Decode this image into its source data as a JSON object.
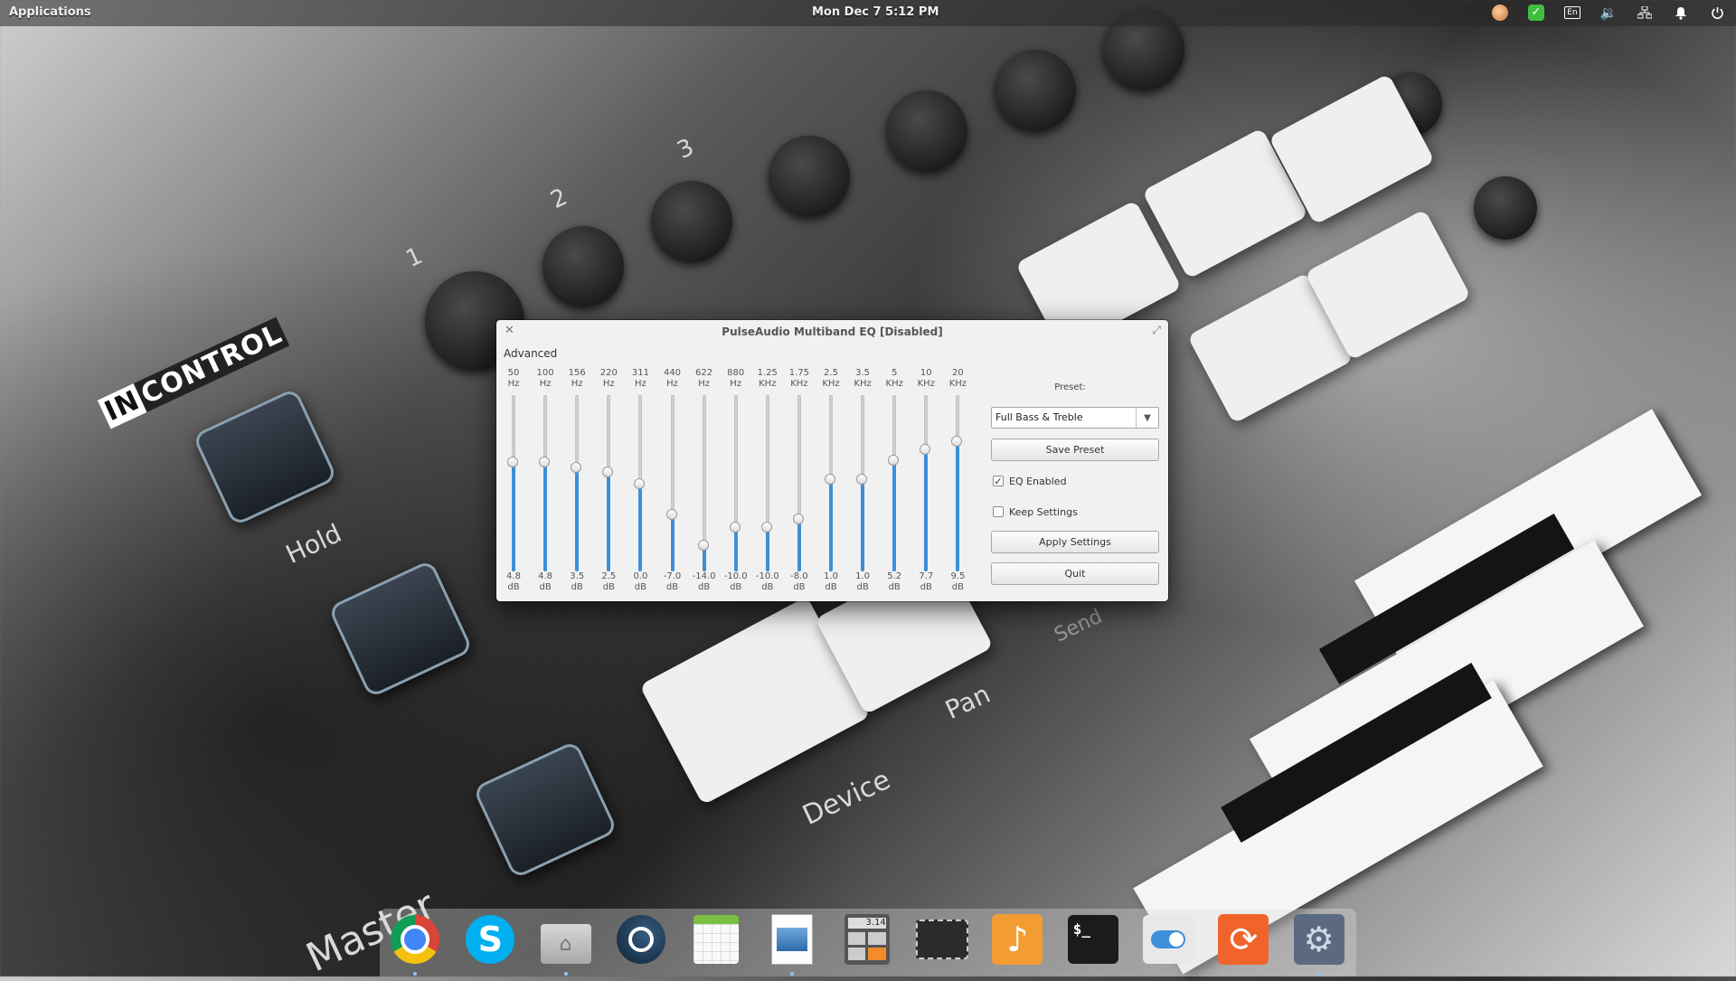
{
  "top_panel": {
    "applications": "Applications",
    "clock": "Mon Dec 7   5:12 PM",
    "keyboard_layout": "En"
  },
  "wallpaper": {
    "brand": "INCONTROL",
    "brand_in": "IN",
    "brand_control": "CONTROL",
    "hold": "Hold",
    "device": "Device",
    "pan": "Pan",
    "master": "Master",
    "send": "Send",
    "knob1": "1",
    "knob2": "2",
    "knob3": "3"
  },
  "eq_window": {
    "title": "PulseAudio Multiband EQ [Disabled]",
    "section": "Advanced",
    "bands": [
      {
        "freq": "50",
        "unit": "Hz",
        "value": "4.8",
        "db": "dB",
        "gain": 4.8
      },
      {
        "freq": "100",
        "unit": "Hz",
        "value": "4.8",
        "db": "dB",
        "gain": 4.8
      },
      {
        "freq": "156",
        "unit": "Hz",
        "value": "3.5",
        "db": "dB",
        "gain": 3.5
      },
      {
        "freq": "220",
        "unit": "Hz",
        "value": "2.5",
        "db": "dB",
        "gain": 2.5
      },
      {
        "freq": "311",
        "unit": "Hz",
        "value": "0.0",
        "db": "dB",
        "gain": 0.0
      },
      {
        "freq": "440",
        "unit": "Hz",
        "value": "-7.0",
        "db": "dB",
        "gain": -7.0
      },
      {
        "freq": "622",
        "unit": "Hz",
        "value": "-14.0",
        "db": "dB",
        "gain": -14.0
      },
      {
        "freq": "880",
        "unit": "Hz",
        "value": "-10.0",
        "db": "dB",
        "gain": -10.0
      },
      {
        "freq": "1.25",
        "unit": "KHz",
        "value": "-10.0",
        "db": "dB",
        "gain": -10.0
      },
      {
        "freq": "1.75",
        "unit": "KHz",
        "value": "-8.0",
        "db": "dB",
        "gain": -8.0
      },
      {
        "freq": "2.5",
        "unit": "KHz",
        "value": "1.0",
        "db": "dB",
        "gain": 1.0
      },
      {
        "freq": "3.5",
        "unit": "KHz",
        "value": "1.0",
        "db": "dB",
        "gain": 1.0
      },
      {
        "freq": "5",
        "unit": "KHz",
        "value": "5.2",
        "db": "dB",
        "gain": 5.2
      },
      {
        "freq": "10",
        "unit": "KHz",
        "value": "7.7",
        "db": "dB",
        "gain": 7.7
      },
      {
        "freq": "20",
        "unit": "KHz",
        "value": "9.5",
        "db": "dB",
        "gain": 9.5
      }
    ],
    "preset_label": "Preset:",
    "preset_value": "Full Bass & Treble",
    "save_preset": "Save Preset",
    "eq_enabled": "EQ Enabled",
    "eq_enabled_checked": true,
    "keep_settings": "Keep Settings",
    "keep_settings_checked": false,
    "apply_settings": "Apply Settings",
    "quit": "Quit"
  },
  "dock": {
    "items": [
      {
        "name": "chrome-icon"
      },
      {
        "name": "skype-icon"
      },
      {
        "name": "files-icon"
      },
      {
        "name": "steam-icon"
      },
      {
        "name": "calendar-icon"
      },
      {
        "name": "image-viewer-icon"
      },
      {
        "name": "calculator-icon",
        "label": "3.14"
      },
      {
        "name": "screenshot-icon"
      },
      {
        "name": "music-icon"
      },
      {
        "name": "terminal-icon",
        "label": "$_"
      },
      {
        "name": "switchboard-toggle-icon"
      },
      {
        "name": "update-manager-icon"
      },
      {
        "name": "system-settings-icon"
      }
    ]
  }
}
